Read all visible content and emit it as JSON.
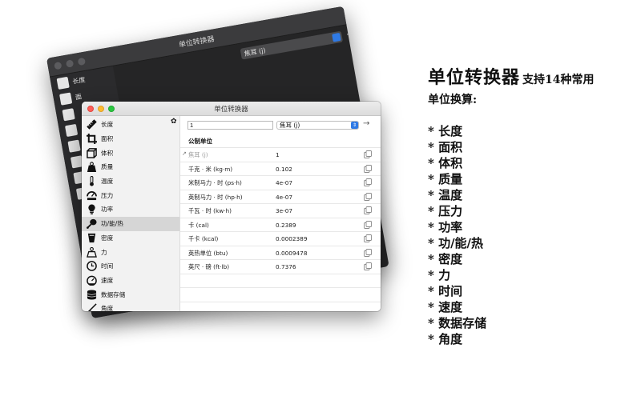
{
  "back_window": {
    "title": "单位转换器",
    "unit": "焦耳 (j)",
    "sidebar_first": "长度",
    "sidebar_second": "面"
  },
  "window": {
    "title": "单位转换器",
    "amount_value": "1",
    "selected_unit": "焦耳 (j)",
    "section_title": "公制单位"
  },
  "sidebar": {
    "items": [
      {
        "label": "长度",
        "icon": "ruler-icon"
      },
      {
        "label": "面积",
        "icon": "crop-icon"
      },
      {
        "label": "体积",
        "icon": "cube-icon"
      },
      {
        "label": "质量",
        "icon": "weight-icon"
      },
      {
        "label": "温度",
        "icon": "thermometer-icon"
      },
      {
        "label": "压力",
        "icon": "gauge-icon"
      },
      {
        "label": "功率",
        "icon": "bulb-icon"
      },
      {
        "label": "功/能/热",
        "icon": "drumstick-icon"
      },
      {
        "label": "密度",
        "icon": "beaker-icon"
      },
      {
        "label": "力",
        "icon": "force-icon"
      },
      {
        "label": "时间",
        "icon": "clock-icon"
      },
      {
        "label": "速度",
        "icon": "speedometer-icon"
      },
      {
        "label": "数据存储",
        "icon": "database-icon"
      },
      {
        "label": "角度",
        "icon": "angle-icon"
      }
    ],
    "active_index": 7
  },
  "results": [
    {
      "name": "焦耳 (j)",
      "value": "1"
    },
    {
      "name": "千克 · 米 (kg·m)",
      "value": "0.102"
    },
    {
      "name": "米制马力 · 时 (ps·h)",
      "value": "4e-07"
    },
    {
      "name": "英制马力 · 时 (hp·h)",
      "value": "4e-07"
    },
    {
      "name": "千瓦 · 时 (kw·h)",
      "value": "3e-07"
    },
    {
      "name": "卡 (cal)",
      "value": "0.2389"
    },
    {
      "name": "千卡 (kcal)",
      "value": "0.0002389"
    },
    {
      "name": "英热单位 (btu)",
      "value": "0.0009478"
    },
    {
      "name": "英尺 · 磅 (ft·lb)",
      "value": "0.7376"
    }
  ],
  "promo": {
    "title": "单位转换器",
    "subtitle_part1": "支持14种常用",
    "subtitle_part2": "单位换算:",
    "features": [
      "* 长度",
      "* 面积",
      "* 体积",
      "* 质量",
      "* 温度",
      "* 压力",
      "* 功率",
      "* 功/能/热",
      "* 密度",
      "* 力",
      "* 时间",
      "* 速度",
      "* 数据存储",
      "* 角度"
    ]
  },
  "colors": {
    "accent": "#2f7ae5",
    "close": "#fd5e57",
    "minimize": "#febb2e",
    "maximize": "#2bc840"
  }
}
